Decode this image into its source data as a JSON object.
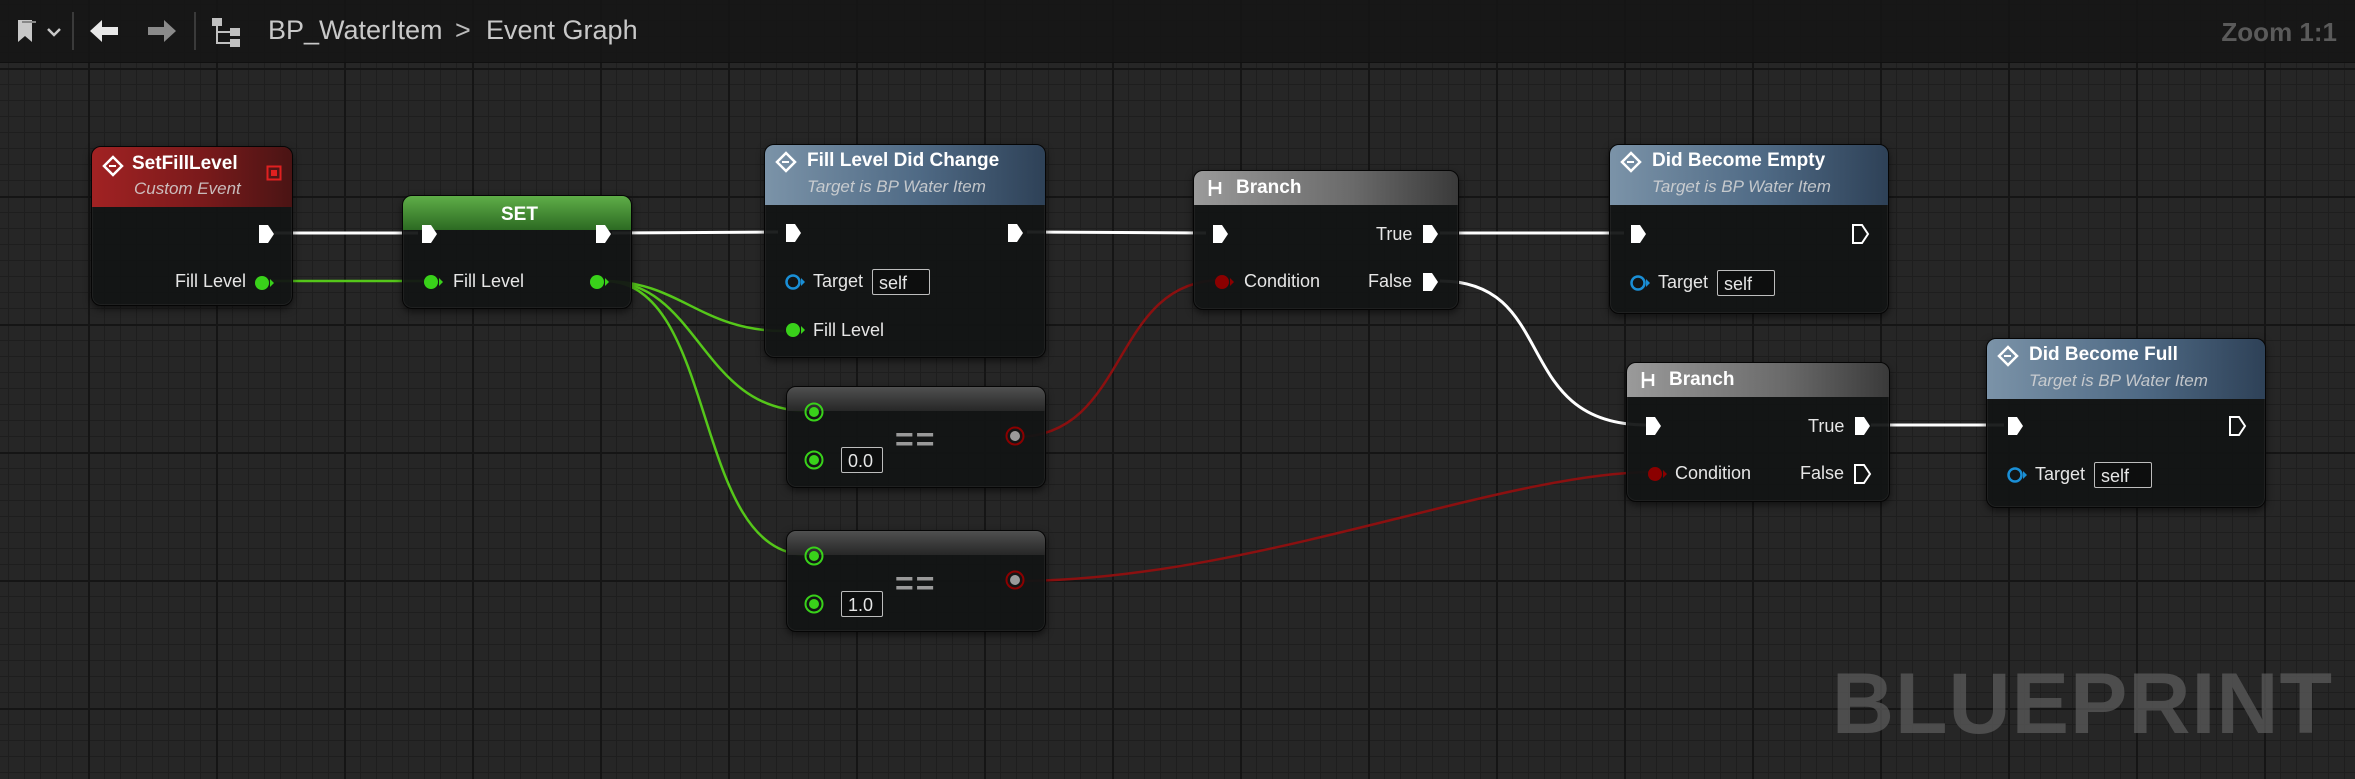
{
  "toolbar": {
    "blueprint_name": "BP_WaterItem",
    "breadcrumb_separator": ">",
    "graph_name": "Event Graph",
    "zoom_label": "Zoom 1:1"
  },
  "watermark": "BLUEPRINT",
  "colors": {
    "exec_wire": "#ffffff",
    "float_wire": "#55c71a",
    "bool_wire": "#8b1010",
    "float_pin": "#39d11a",
    "bool_pin": "#8b0000",
    "object_pin": "#1a8fd6",
    "event_header": "#a12223",
    "function_header": "#5a7896",
    "set_header": "#4a9a38"
  },
  "nodes": {
    "set_fill_level_event": {
      "title": "SetFillLevel",
      "subtitle": "Custom Event",
      "out_pin": "Fill Level"
    },
    "set_node": {
      "title": "SET",
      "in_pin": "Fill Level"
    },
    "fill_level_did_change": {
      "title": "Fill Level Did Change",
      "subtitle": "Target is BP Water Item",
      "target_label": "Target",
      "target_value": "self",
      "fill_level_label": "Fill Level"
    },
    "equals_zero": {
      "operator": "==",
      "value": "0.0"
    },
    "equals_one": {
      "operator": "==",
      "value": "1.0"
    },
    "branch_1": {
      "title": "Branch",
      "condition_label": "Condition",
      "true_label": "True",
      "false_label": "False"
    },
    "branch_2": {
      "title": "Branch",
      "condition_label": "Condition",
      "true_label": "True",
      "false_label": "False"
    },
    "did_become_empty": {
      "title": "Did Become Empty",
      "subtitle": "Target is BP Water Item",
      "target_label": "Target",
      "target_value": "self"
    },
    "did_become_full": {
      "title": "Did Become Full",
      "subtitle": "Target is BP Water Item",
      "target_label": "Target",
      "target_value": "self"
    }
  }
}
